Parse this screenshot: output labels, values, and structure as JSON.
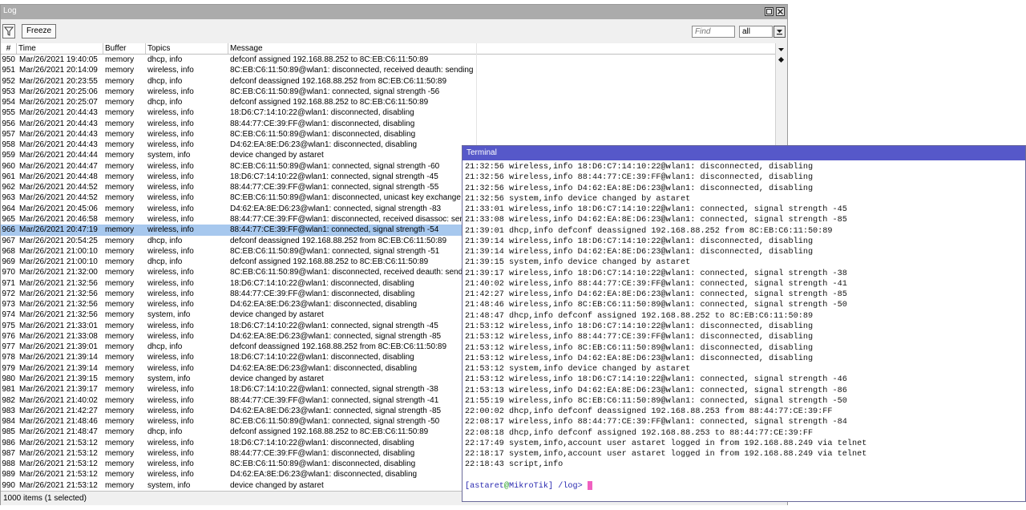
{
  "log_window": {
    "title": "Log",
    "freeze_label": "Freeze",
    "find_placeholder": "Find",
    "topic_filter": "all",
    "status": "1000 items (1 selected)",
    "columns": [
      "#",
      "Time",
      "Buffer",
      "Topics",
      "Message"
    ],
    "selected_row": "966",
    "rows": [
      [
        "950",
        "Mar/26/2021 19:40:05",
        "memory",
        "dhcp, info",
        "defconf assigned 192.168.88.252 to 8C:EB:C6:11:50:89"
      ],
      [
        "951",
        "Mar/26/2021 20:14:09",
        "memory",
        "wireless, info",
        "8C:EB:C6:11:50:89@wlan1: disconnected, received deauth: sending s..."
      ],
      [
        "952",
        "Mar/26/2021 20:23:55",
        "memory",
        "dhcp, info",
        "defconf deassigned 192.168.88.252 from 8C:EB:C6:11:50:89"
      ],
      [
        "953",
        "Mar/26/2021 20:25:06",
        "memory",
        "wireless, info",
        "8C:EB:C6:11:50:89@wlan1: connected, signal strength -56"
      ],
      [
        "954",
        "Mar/26/2021 20:25:07",
        "memory",
        "dhcp, info",
        "defconf assigned 192.168.88.252 to 8C:EB:C6:11:50:89"
      ],
      [
        "955",
        "Mar/26/2021 20:44:43",
        "memory",
        "wireless, info",
        "18:D6:C7:14:10:22@wlan1: disconnected, disabling"
      ],
      [
        "956",
        "Mar/26/2021 20:44:43",
        "memory",
        "wireless, info",
        "88:44:77:CE:39:FF@wlan1: disconnected, disabling"
      ],
      [
        "957",
        "Mar/26/2021 20:44:43",
        "memory",
        "wireless, info",
        "8C:EB:C6:11:50:89@wlan1: disconnected, disabling"
      ],
      [
        "958",
        "Mar/26/2021 20:44:43",
        "memory",
        "wireless, info",
        "D4:62:EA:8E:D6:23@wlan1: disconnected, disabling"
      ],
      [
        "959",
        "Mar/26/2021 20:44:44",
        "memory",
        "system, info",
        "device changed by astaret"
      ],
      [
        "960",
        "Mar/26/2021 20:44:47",
        "memory",
        "wireless, info",
        "8C:EB:C6:11:50:89@wlan1: connected, signal strength -60"
      ],
      [
        "961",
        "Mar/26/2021 20:44:48",
        "memory",
        "wireless, info",
        "18:D6:C7:14:10:22@wlan1: connected, signal strength -45"
      ],
      [
        "962",
        "Mar/26/2021 20:44:52",
        "memory",
        "wireless, info",
        "88:44:77:CE:39:FF@wlan1: connected, signal strength -55"
      ],
      [
        "963",
        "Mar/26/2021 20:44:52",
        "memory",
        "wireless, info",
        "8C:EB:C6:11:50:89@wlan1: disconnected, unicast key exchange time"
      ],
      [
        "964",
        "Mar/26/2021 20:45:06",
        "memory",
        "wireless, info",
        "D4:62:EA:8E:D6:23@wlan1: connected, signal strength -83"
      ],
      [
        "965",
        "Mar/26/2021 20:46:58",
        "memory",
        "wireless, info",
        "88:44:77:CE:39:FF@wlan1: disconnected, received disassoc: sending"
      ],
      [
        "966",
        "Mar/26/2021 20:47:19",
        "memory",
        "wireless, info",
        "88:44:77:CE:39:FF@wlan1: connected, signal strength -54"
      ],
      [
        "967",
        "Mar/26/2021 20:54:25",
        "memory",
        "dhcp, info",
        "defconf deassigned 192.168.88.252 from 8C:EB:C6:11:50:89"
      ],
      [
        "968",
        "Mar/26/2021 21:00:10",
        "memory",
        "wireless, info",
        "8C:EB:C6:11:50:89@wlan1: connected, signal strength -51"
      ],
      [
        "969",
        "Mar/26/2021 21:00:10",
        "memory",
        "dhcp, info",
        "defconf assigned 192.168.88.252 to 8C:EB:C6:11:50:89"
      ],
      [
        "970",
        "Mar/26/2021 21:32:00",
        "memory",
        "wireless, info",
        "8C:EB:C6:11:50:89@wlan1: disconnected, received deauth: sending"
      ],
      [
        "971",
        "Mar/26/2021 21:32:56",
        "memory",
        "wireless, info",
        "18:D6:C7:14:10:22@wlan1: disconnected, disabling"
      ],
      [
        "972",
        "Mar/26/2021 21:32:56",
        "memory",
        "wireless, info",
        "88:44:77:CE:39:FF@wlan1: disconnected, disabling"
      ],
      [
        "973",
        "Mar/26/2021 21:32:56",
        "memory",
        "wireless, info",
        "D4:62:EA:8E:D6:23@wlan1: disconnected, disabling"
      ],
      [
        "974",
        "Mar/26/2021 21:32:56",
        "memory",
        "system, info",
        "device changed by astaret"
      ],
      [
        "975",
        "Mar/26/2021 21:33:01",
        "memory",
        "wireless, info",
        "18:D6:C7:14:10:22@wlan1: connected, signal strength -45"
      ],
      [
        "976",
        "Mar/26/2021 21:33:08",
        "memory",
        "wireless, info",
        "D4:62:EA:8E:D6:23@wlan1: connected, signal strength -85"
      ],
      [
        "977",
        "Mar/26/2021 21:39:01",
        "memory",
        "dhcp, info",
        "defconf deassigned 192.168.88.252 from 8C:EB:C6:11:50:89"
      ],
      [
        "978",
        "Mar/26/2021 21:39:14",
        "memory",
        "wireless, info",
        "18:D6:C7:14:10:22@wlan1: disconnected, disabling"
      ],
      [
        "979",
        "Mar/26/2021 21:39:14",
        "memory",
        "wireless, info",
        "D4:62:EA:8E:D6:23@wlan1: disconnected, disabling"
      ],
      [
        "980",
        "Mar/26/2021 21:39:15",
        "memory",
        "system, info",
        "device changed by astaret"
      ],
      [
        "981",
        "Mar/26/2021 21:39:17",
        "memory",
        "wireless, info",
        "18:D6:C7:14:10:22@wlan1: connected, signal strength -38"
      ],
      [
        "982",
        "Mar/26/2021 21:40:02",
        "memory",
        "wireless, info",
        "88:44:77:CE:39:FF@wlan1: connected, signal strength -41"
      ],
      [
        "983",
        "Mar/26/2021 21:42:27",
        "memory",
        "wireless, info",
        "D4:62:EA:8E:D6:23@wlan1: connected, signal strength -85"
      ],
      [
        "984",
        "Mar/26/2021 21:48:46",
        "memory",
        "wireless, info",
        "8C:EB:C6:11:50:89@wlan1: connected, signal strength -50"
      ],
      [
        "985",
        "Mar/26/2021 21:48:47",
        "memory",
        "dhcp, info",
        "defconf assigned 192.168.88.252 to 8C:EB:C6:11:50:89"
      ],
      [
        "986",
        "Mar/26/2021 21:53:12",
        "memory",
        "wireless, info",
        "18:D6:C7:14:10:22@wlan1: disconnected, disabling"
      ],
      [
        "987",
        "Mar/26/2021 21:53:12",
        "memory",
        "wireless, info",
        "88:44:77:CE:39:FF@wlan1: disconnected, disabling"
      ],
      [
        "988",
        "Mar/26/2021 21:53:12",
        "memory",
        "wireless, info",
        "8C:EB:C6:11:50:89@wlan1: disconnected, disabling"
      ],
      [
        "989",
        "Mar/26/2021 21:53:12",
        "memory",
        "wireless, info",
        "D4:62:EA:8E:D6:23@wlan1: disconnected, disabling"
      ],
      [
        "990",
        "Mar/26/2021 21:53:12",
        "memory",
        "system, info",
        "device changed by astaret"
      ]
    ]
  },
  "terminal": {
    "title": "Terminal",
    "lines": [
      "21:32:56 wireless,info 18:D6:C7:14:10:22@wlan1: disconnected, disabling",
      "21:32:56 wireless,info 88:44:77:CE:39:FF@wlan1: disconnected, disabling",
      "21:32:56 wireless,info D4:62:EA:8E:D6:23@wlan1: disconnected, disabling",
      "21:32:56 system,info device changed by astaret",
      "21:33:01 wireless,info 18:D6:C7:14:10:22@wlan1: connected, signal strength -45",
      "21:33:08 wireless,info D4:62:EA:8E:D6:23@wlan1: connected, signal strength -85",
      "21:39:01 dhcp,info defconf deassigned 192.168.88.252 from 8C:EB:C6:11:50:89",
      "21:39:14 wireless,info 18:D6:C7:14:10:22@wlan1: disconnected, disabling",
      "21:39:14 wireless,info D4:62:EA:8E:D6:23@wlan1: disconnected, disabling",
      "21:39:15 system,info device changed by astaret",
      "21:39:17 wireless,info 18:D6:C7:14:10:22@wlan1: connected, signal strength -38",
      "21:40:02 wireless,info 88:44:77:CE:39:FF@wlan1: connected, signal strength -41",
      "21:42:27 wireless,info D4:62:EA:8E:D6:23@wlan1: connected, signal strength -85",
      "21:48:46 wireless,info 8C:EB:C6:11:50:89@wlan1: connected, signal strength -50",
      "21:48:47 dhcp,info defconf assigned 192.168.88.252 to 8C:EB:C6:11:50:89",
      "21:53:12 wireless,info 18:D6:C7:14:10:22@wlan1: disconnected, disabling",
      "21:53:12 wireless,info 88:44:77:CE:39:FF@wlan1: disconnected, disabling",
      "21:53:12 wireless,info 8C:EB:C6:11:50:89@wlan1: disconnected, disabling",
      "21:53:12 wireless,info D4:62:EA:8E:D6:23@wlan1: disconnected, disabling",
      "21:53:12 system,info device changed by astaret",
      "21:53:12 wireless,info 18:D6:C7:14:10:22@wlan1: connected, signal strength -46",
      "21:53:13 wireless,info D4:62:EA:8E:D6:23@wlan1: connected, signal strength -86",
      "21:55:19 wireless,info 8C:EB:C6:11:50:89@wlan1: connected, signal strength -50",
      "22:00:02 dhcp,info defconf deassigned 192.168.88.253 from 88:44:77:CE:39:FF",
      "22:08:17 wireless,info 88:44:77:CE:39:FF@wlan1: connected, signal strength -84",
      "22:08:18 dhcp,info defconf assigned 192.168.88.253 to 88:44:77:CE:39:FF",
      "22:17:49 system,info,account user astaret logged in from 192.168.88.249 via telnet",
      "22:18:17 system,info,account user astaret logged in from 192.168.88.249 via telnet",
      "22:18:43 script,info"
    ],
    "prompt": {
      "open": "[",
      "user": "astaret",
      "at": "@",
      "host": "MikroTik",
      "close": "]",
      "path": " /log>"
    }
  },
  "icons": {
    "filter": "filter-icon",
    "restore": "restore-icon",
    "close": "close-icon",
    "dropdown": "dropdown-arrow-icon",
    "scroll_down": "scroll-down-icon",
    "scroll_marker": "scroll-position-icon"
  },
  "colors": {
    "terminal_titlebar": "#5658c9",
    "log_titlebar": "#ababab",
    "selection": "#a7c8ee",
    "cursor": "#f060c0"
  }
}
